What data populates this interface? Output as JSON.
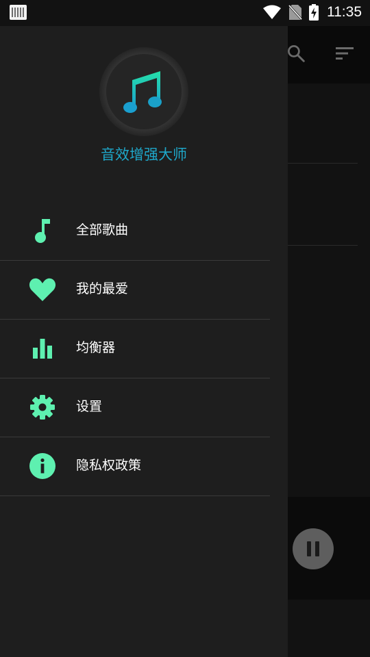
{
  "status_bar": {
    "time": "11:35",
    "icons": [
      "notification-icon",
      "wifi-icon",
      "no-sim-icon",
      "battery-charging-icon"
    ]
  },
  "drawer": {
    "app_name": "音效增强大师",
    "logo": "music-note-icon",
    "items": [
      {
        "label": "全部歌曲",
        "icon": "music-note-icon"
      },
      {
        "label": "我的最爱",
        "icon": "heart-icon"
      },
      {
        "label": "均衡器",
        "icon": "equalizer-icon"
      },
      {
        "label": "设置",
        "icon": "gear-icon"
      },
      {
        "label": "隐私权政策",
        "icon": "info-icon"
      }
    ]
  },
  "background": {
    "toolbar_icons": [
      "search-icon",
      "sort-icon"
    ],
    "player_control": "pause-icon"
  },
  "colors": {
    "accent": "#5ef0b0",
    "title": "#1ea7c9",
    "drawer_bg": "#1e1e1e"
  }
}
